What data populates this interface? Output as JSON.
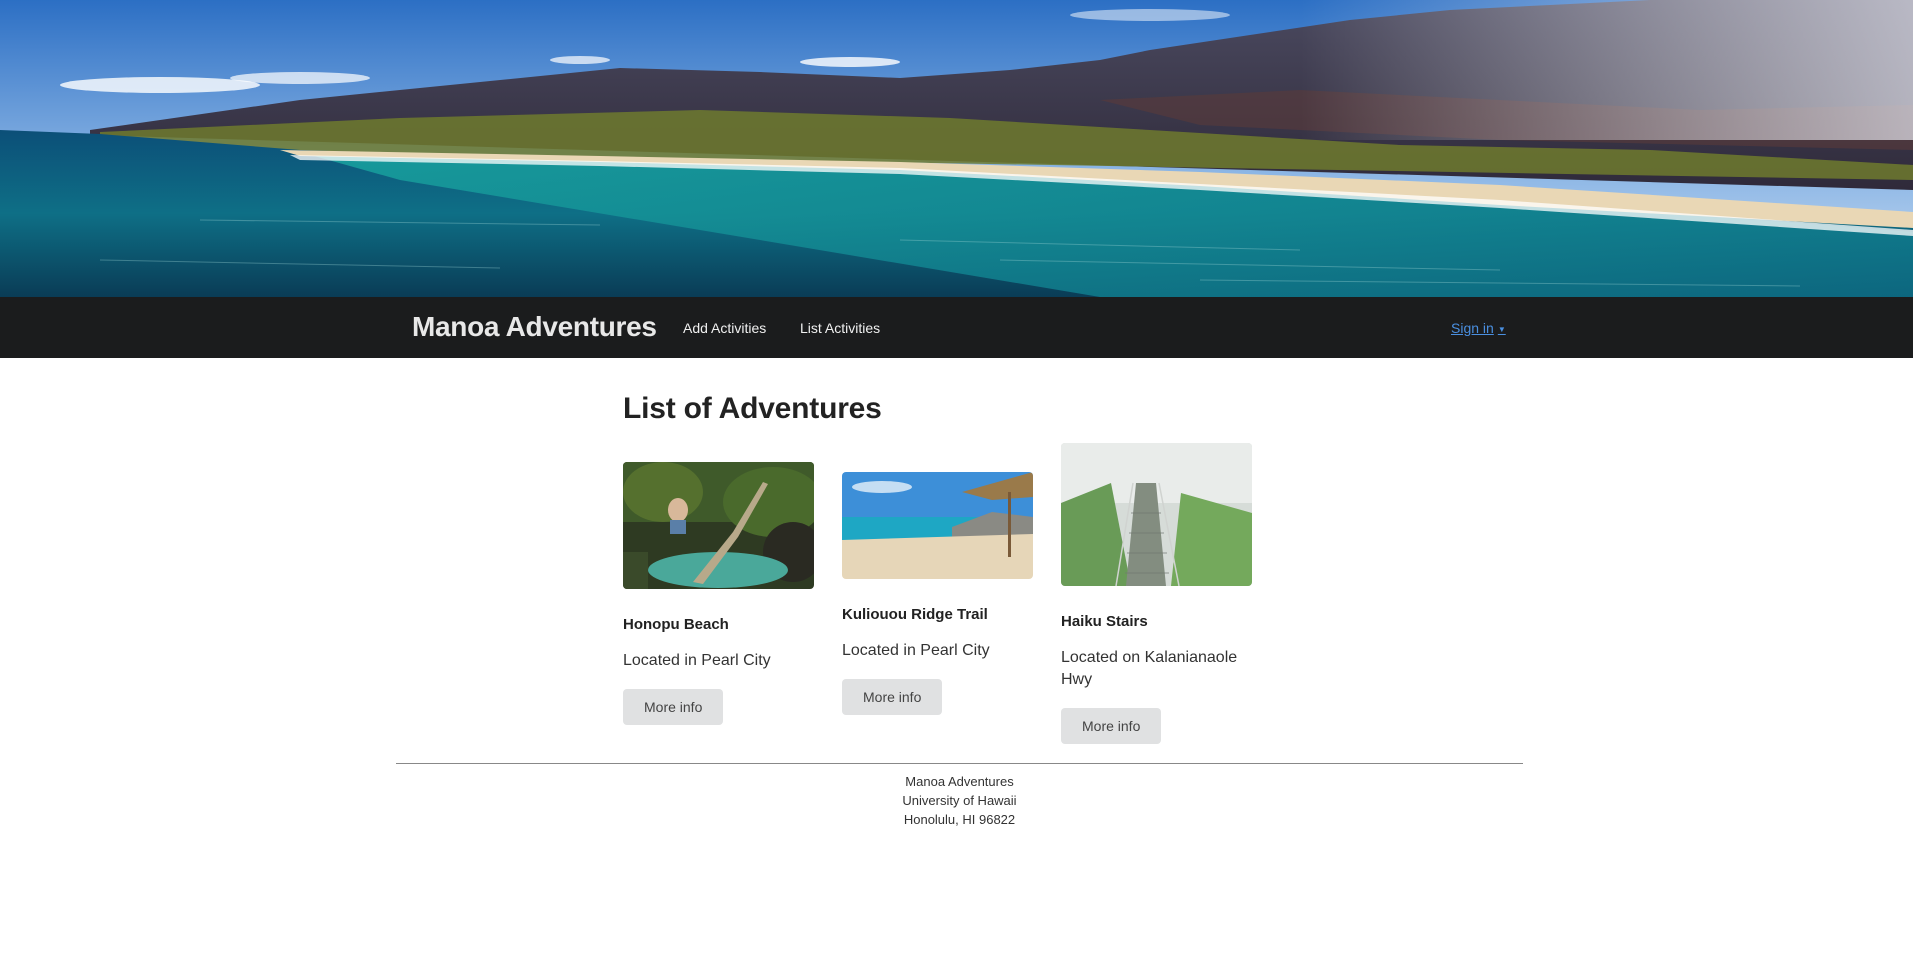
{
  "navbar": {
    "brand": "Manoa Adventures",
    "links": [
      {
        "label": "Add Activities"
      },
      {
        "label": "List Activities"
      }
    ],
    "signin": {
      "label": "Sign in",
      "caret": "▼"
    }
  },
  "main": {
    "title": "List of Adventures",
    "cards": [
      {
        "name": "Honopu Beach",
        "location": "Located in Pearl City",
        "button": "More info"
      },
      {
        "name": "Kuliouou Ridge Trail",
        "location": "Located in Pearl City",
        "button": "More info"
      },
      {
        "name": "Haiku Stairs",
        "location": "Located on Kalanianaole Hwy",
        "button": "More info"
      }
    ]
  },
  "footer": {
    "lines": [
      "Manoa Adventures",
      "University of Hawaii",
      "Honolulu, HI 96822"
    ]
  },
  "colors": {
    "navbar_bg": "#1b1c1d",
    "signin_link": "#4a8fe0",
    "button_bg": "#e0e1e2"
  }
}
